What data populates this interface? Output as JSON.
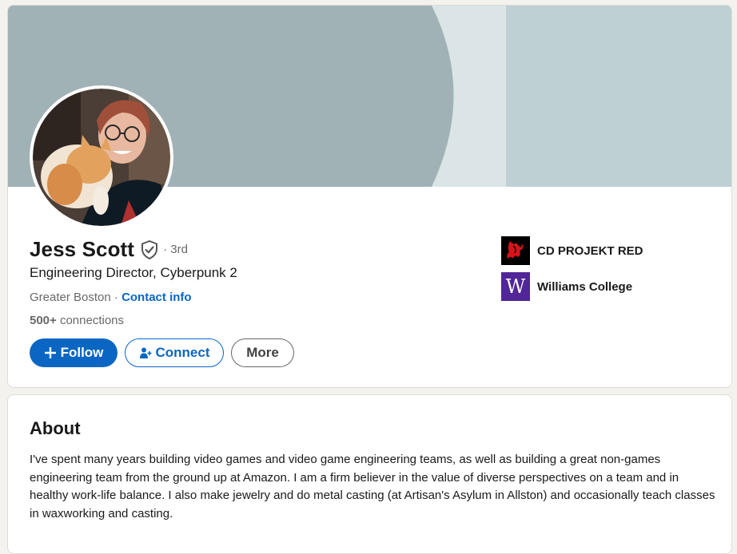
{
  "profile": {
    "name": "Jess Scott",
    "degree": "· 3rd",
    "headline": "Engineering Director, Cyberpunk 2",
    "location": "Greater Boston",
    "location_separator": " · ",
    "contact_info_label": "Contact info",
    "connections_count": "500+",
    "connections_label": " connections"
  },
  "actions": {
    "follow_label": "Follow",
    "connect_label": "Connect",
    "more_label": "More"
  },
  "orgs": [
    {
      "name": "CD PROJEKT RED",
      "logo": "cdpr-logo"
    },
    {
      "name": "Williams College",
      "logo": "williams-logo",
      "logo_letter": "W"
    }
  ],
  "about": {
    "title": "About",
    "text": "I've spent many years building video games and video game engineering teams, as well as building a great non-games engineering team from the ground up at Amazon. I am a firm believer in the value of diverse perspectives on a team and in healthy work-life balance. I also make jewelry and do metal casting (at Artisan's Asylum in Allston) and occasionally teach classes in waxworking and casting."
  },
  "colors": {
    "primary": "#0a66c2",
    "banner_main": "#a1b2b6",
    "banner_light": "#dbe5e7",
    "banner_right": "#bfd0d5",
    "williams_purple": "#512698"
  },
  "icons": [
    "verified-icon",
    "plus-icon",
    "add-person-icon"
  ]
}
